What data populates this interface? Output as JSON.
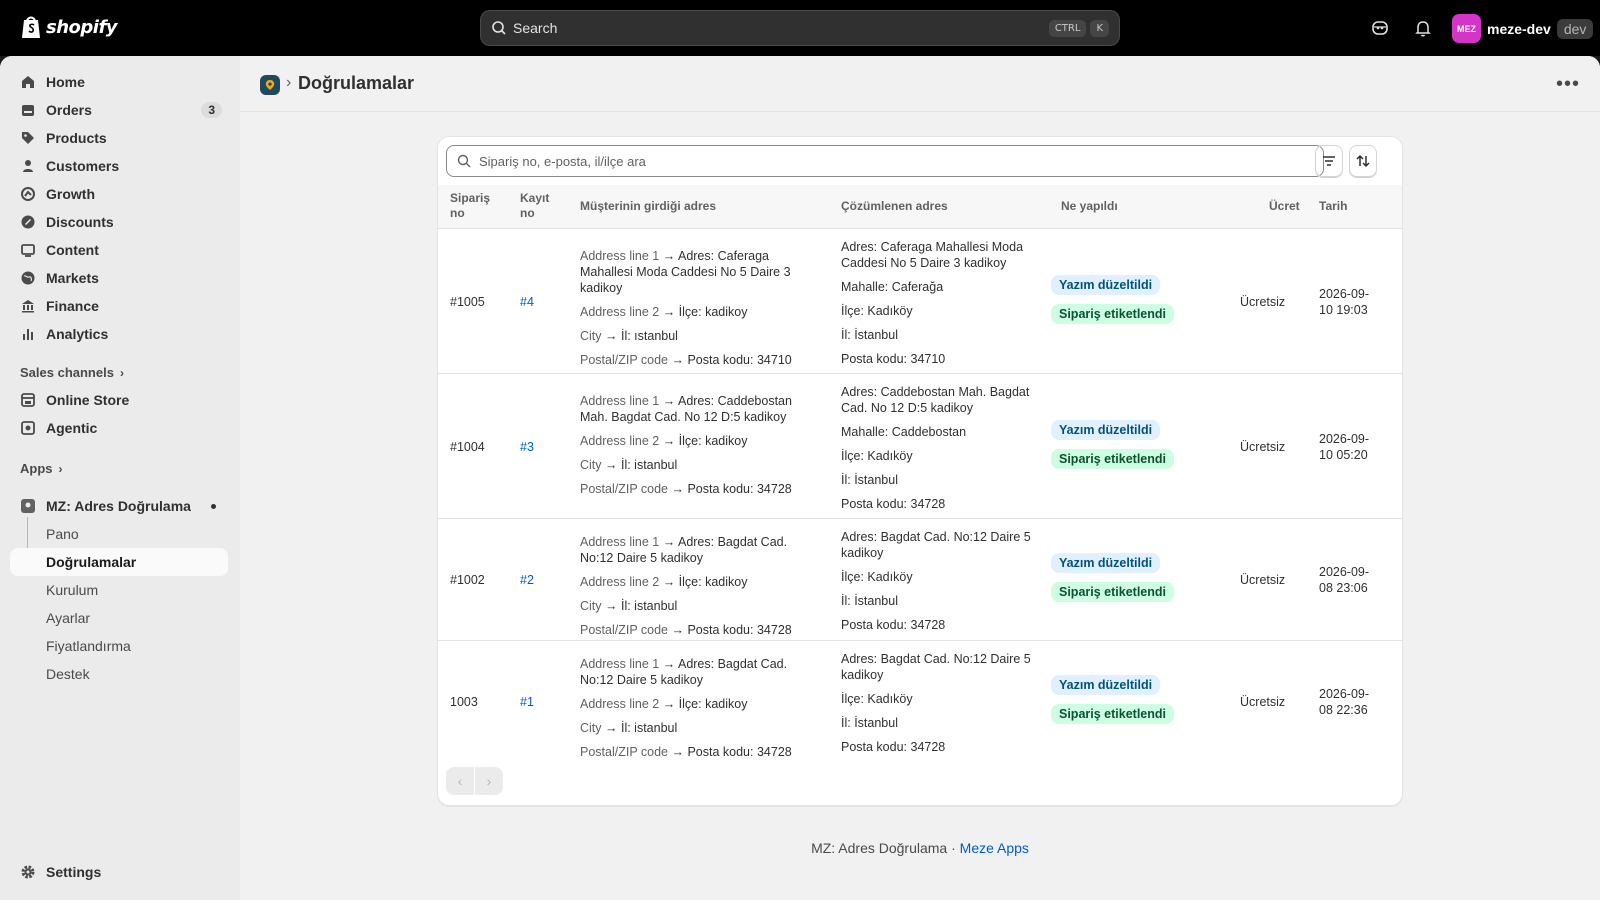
{
  "topbar": {
    "logo_text": "shopify",
    "search_placeholder": "Search",
    "shortcut_keys": [
      "CTRL",
      "K"
    ],
    "user_initials": "MEZ",
    "user_name": "meze-dev",
    "store_badge": "dev",
    "avatar_color": "#d434c8"
  },
  "sidebar": {
    "items": [
      {
        "label": "Home",
        "icon": "home-icon"
      },
      {
        "label": "Orders",
        "icon": "orders-icon",
        "count": "3"
      },
      {
        "label": "Products",
        "icon": "tag-icon"
      },
      {
        "label": "Customers",
        "icon": "person-icon"
      },
      {
        "label": "Growth",
        "icon": "growth-icon"
      },
      {
        "label": "Discounts",
        "icon": "discount-icon"
      },
      {
        "label": "Content",
        "icon": "content-icon"
      },
      {
        "label": "Markets",
        "icon": "globe-icon"
      },
      {
        "label": "Finance",
        "icon": "bank-icon"
      },
      {
        "label": "Analytics",
        "icon": "bar-chart-icon"
      }
    ],
    "sales_channels_label": "Sales channels",
    "channels": [
      {
        "label": "Online Store",
        "icon": "store-icon"
      },
      {
        "label": "Agentic",
        "icon": "agentic-icon"
      }
    ],
    "apps_label": "Apps",
    "app_name": "MZ: Adres Doğrulama",
    "app_subitems": [
      "Pano",
      "Doğrulamalar",
      "Kurulum",
      "Ayarlar",
      "Fiyatlandırma",
      "Destek"
    ],
    "settings_label": "Settings"
  },
  "page": {
    "title": "Doğrulamalar",
    "breadcrumb_sep": "›"
  },
  "table": {
    "search_placeholder": "Sipariş no, e-posta, il/ilçe ara",
    "headers": {
      "order": [
        "Sipariş",
        "no"
      ],
      "record": [
        "Kayıt",
        "no"
      ],
      "entered": "Müşterinin girdiği adres",
      "resolved": "Çözümlenen adres",
      "action": "Ne yapıldı",
      "fee": "Ücret",
      "date": "Tarih"
    },
    "rows": [
      {
        "order": "#1005",
        "record": "#4",
        "entered": [
          {
            "label": "Address line 1",
            "value": "Adres: Caferaga Mahallesi Moda Caddesi No 5 Daire 3 kadikoy"
          },
          {
            "label": "Address line 2",
            "value": "İlçe: kadikoy"
          },
          {
            "label": "City",
            "value": "İl: ıstanbul"
          },
          {
            "label": "Postal/ZIP code",
            "value": "Posta kodu: 34710"
          }
        ],
        "resolved": [
          "Adres: Caferaga Mahallesi Moda Caddesi No 5 Daire 3 kadikoy",
          "Mahalle: Caferağa",
          "İlçe: Kadıköy",
          "İl: İstanbul",
          "Posta kodu: 34710"
        ],
        "badges": [
          "Yazım düzeltildi",
          "Sipariş etiketlendi"
        ],
        "fee": "Ücretsiz",
        "date": [
          "2026-09-",
          "10 19:03"
        ]
      },
      {
        "order": "#1004",
        "record": "#3",
        "entered": [
          {
            "label": "Address line 1",
            "value": "Adres: Caddebostan Mah. Bagdat Cad. No 12 D:5 kadikoy"
          },
          {
            "label": "Address line 2",
            "value": "İlçe: kadikoy"
          },
          {
            "label": "City",
            "value": "İl: istanbul"
          },
          {
            "label": "Postal/ZIP code",
            "value": "Posta kodu: 34728"
          }
        ],
        "resolved": [
          "Adres: Caddebostan Mah. Bagdat Cad. No 12 D:5 kadikoy",
          "Mahalle: Caddebostan",
          "İlçe: Kadıköy",
          "İl: İstanbul",
          "Posta kodu: 34728"
        ],
        "badges": [
          "Yazım düzeltildi",
          "Sipariş etiketlendi"
        ],
        "fee": "Ücretsiz",
        "date": [
          "2026-09-",
          "10 05:20"
        ]
      },
      {
        "order": "#1002",
        "record": "#2",
        "entered": [
          {
            "label": "Address line 1",
            "value": "Adres: Bagdat Cad. No:12 Daire 5 kadikoy"
          },
          {
            "label": "Address line 2",
            "value": "İlçe: kadikoy"
          },
          {
            "label": "City",
            "value": "İl: istanbul"
          },
          {
            "label": "Postal/ZIP code",
            "value": "Posta kodu: 34728"
          }
        ],
        "resolved": [
          "Adres: Bagdat Cad. No:12 Daire 5 kadikoy",
          "İlçe: Kadıköy",
          "İl: İstanbul",
          "Posta kodu: 34728"
        ],
        "badges": [
          "Yazım düzeltildi",
          "Sipariş etiketlendi"
        ],
        "fee": "Ücretsiz",
        "date": [
          "2026-09-",
          "08 23:06"
        ]
      },
      {
        "order": "1003",
        "record": "#1",
        "entered": [
          {
            "label": "Address line 1",
            "value": "Adres: Bagdat Cad. No:12 Daire 5 kadikoy"
          },
          {
            "label": "Address line 2",
            "value": "İlçe: kadikoy"
          },
          {
            "label": "City",
            "value": "İl: istanbul"
          },
          {
            "label": "Postal/ZIP code",
            "value": "Posta kodu: 34728"
          }
        ],
        "resolved": [
          "Adres: Bagdat Cad. No:12 Daire 5 kadikoy",
          "İlçe: Kadıköy",
          "İl: İstanbul",
          "Posta kodu: 34728"
        ],
        "badges": [
          "Yazım düzeltildi",
          "Sipariş etiketlendi"
        ],
        "fee": "Ücretsiz",
        "date": [
          "2026-09-",
          "08 22:36"
        ]
      }
    ]
  },
  "footer": {
    "app_text": "MZ: Adres Doğrulama ·",
    "vendor_link": "Meze Apps"
  }
}
